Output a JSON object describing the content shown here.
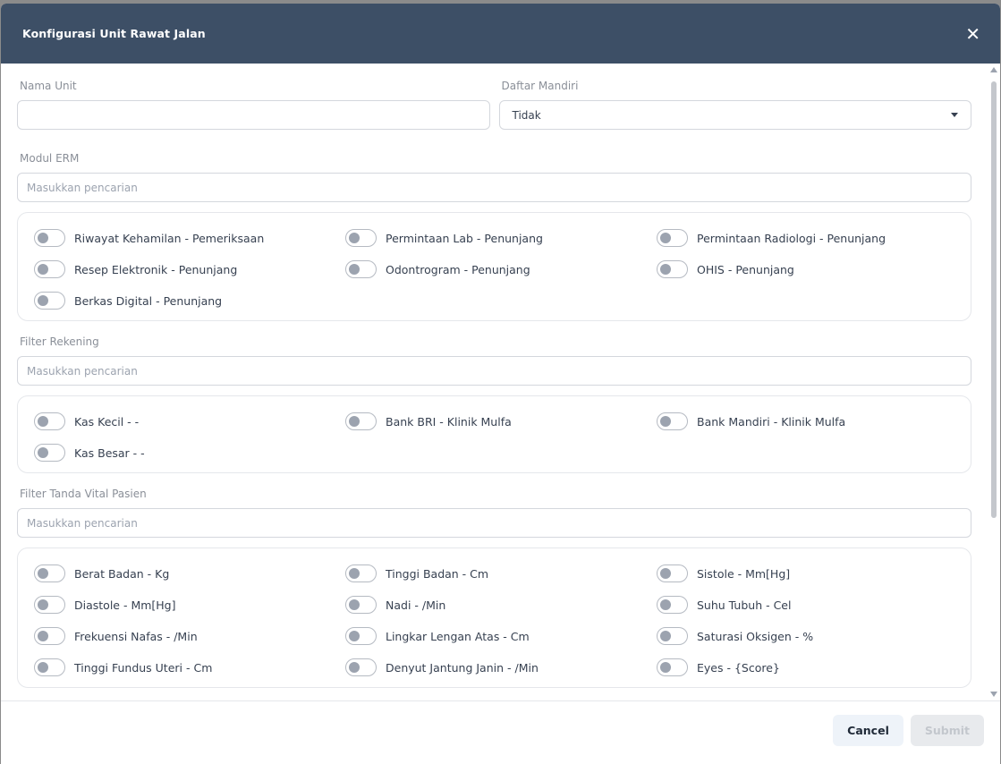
{
  "modal": {
    "title": "Konfigurasi Unit Rawat Jalan",
    "close_symbol": "✕"
  },
  "form": {
    "nama_unit": {
      "label": "Nama Unit",
      "value": ""
    },
    "daftar_mandiri": {
      "label": "Daftar Mandiri",
      "value": "Tidak"
    }
  },
  "modul_erm": {
    "label": "Modul ERM",
    "placeholder": "Masukkan pencarian",
    "items": [
      "Riwayat Kehamilan - Pemeriksaan",
      "Permintaan Lab - Penunjang",
      "Permintaan Radiologi - Penunjang",
      "Resep Elektronik - Penunjang",
      "Odontrogram - Penunjang",
      "OHIS - Penunjang",
      "Berkas Digital - Penunjang"
    ]
  },
  "filter_rekening": {
    "label": "Filter Rekening",
    "placeholder": "Masukkan pencarian",
    "items": [
      "Kas Kecil - -",
      "Bank BRI - Klinik Mulfa",
      "Bank Mandiri - Klinik Mulfa",
      "Kas Besar - -"
    ]
  },
  "filter_tanda_vital": {
    "label": "Filter Tanda Vital Pasien",
    "placeholder": "Masukkan pencarian",
    "items": [
      "Berat Badan - Kg",
      "Tinggi Badan - Cm",
      "Sistole - Mm[Hg]",
      "Diastole - Mm[Hg]",
      "Nadi - /Min",
      "Suhu Tubuh - Cel",
      "Frekuensi Nafas - /Min",
      "Lingkar Lengan Atas - Cm",
      "Saturasi Oksigen - %",
      "Tinggi Fundus Uteri - Cm",
      "Denyut Jantung Janin - /Min",
      "Eyes - {Score}"
    ]
  },
  "footer": {
    "cancel_label": "Cancel",
    "submit_label": "Submit"
  }
}
